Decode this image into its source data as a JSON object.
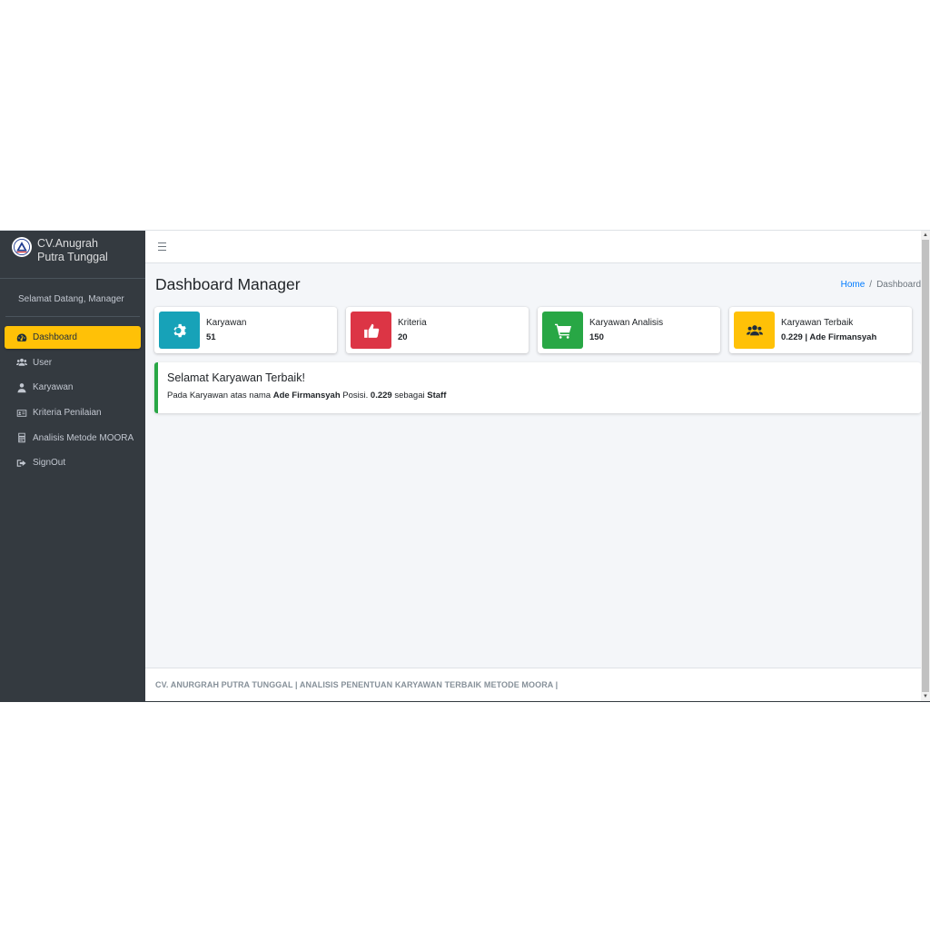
{
  "brand": {
    "line1": "CV.Anugrah",
    "line2": "Putra Tunggal",
    "logo_icon": "triangle-logo-icon"
  },
  "user_panel": {
    "greeting": "Selamat Datang, Manager"
  },
  "sidebar": {
    "items": [
      {
        "label": "Dashboard",
        "icon": "tachometer-icon",
        "active": true
      },
      {
        "label": "User",
        "icon": "users-icon",
        "active": false
      },
      {
        "label": "Karyawan",
        "icon": "user-tie-icon",
        "active": false
      },
      {
        "label": "Kriteria Penilaian",
        "icon": "id-card-icon",
        "active": false
      },
      {
        "label": "Analisis Metode MOORA",
        "icon": "calculator-icon",
        "active": false
      },
      {
        "label": "SignOut",
        "icon": "sign-out-icon",
        "active": false
      }
    ]
  },
  "header": {
    "title": "Dashboard Manager"
  },
  "breadcrumb": {
    "home": "Home",
    "separator": "/",
    "current": "Dashboard"
  },
  "info_boxes": [
    {
      "label": "Karyawan",
      "value": "51",
      "icon": "cog-icon",
      "color": "#17a2b8"
    },
    {
      "label": "Kriteria",
      "value": "20",
      "icon": "thumbs-up-icon",
      "color": "#dc3545"
    },
    {
      "label": "Karyawan Analisis",
      "value": "150",
      "icon": "shopping-cart-icon",
      "color": "#28a745"
    },
    {
      "label": "Karyawan Terbaik",
      "value": "0.229 | Ade Firmansyah",
      "icon": "users-icon",
      "color": "#ffc107"
    }
  ],
  "callout": {
    "title": "Selamat Karyawan Terbaik!",
    "text1": "Pada Karyawan atas nama ",
    "name": "Ade Firmansyah",
    "text2": " Posisi. ",
    "score": "0.229",
    "text3": " sebagai ",
    "position": "Staff",
    "accent_color": "#28a745"
  },
  "footer": {
    "text": "CV. ANURGRAH PUTRA TUNGGAL | ANALISIS PENENTUAN KARYAWAN TERBAIK METODE MOORA |"
  },
  "colors": {
    "sidebar_bg": "#343a40",
    "active_item": "#ffc107",
    "content_bg": "#f4f6f9",
    "link": "#007bff"
  }
}
